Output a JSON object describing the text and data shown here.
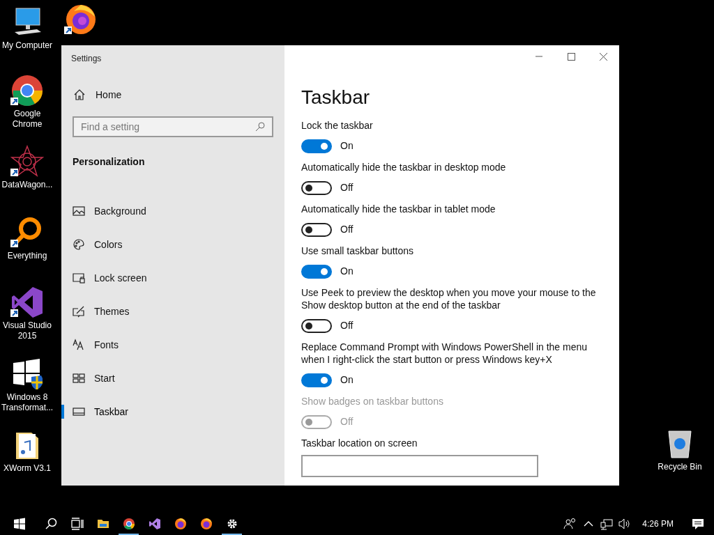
{
  "desktop_icons": [
    {
      "kind": "computer",
      "label": "My Computer",
      "shortcut": false
    },
    {
      "kind": "chrome",
      "label": "Google Chrome",
      "shortcut": true
    },
    {
      "kind": "star",
      "label": "DataWagon...",
      "shortcut": true
    },
    {
      "kind": "magnifier",
      "label": "Everything",
      "shortcut": true
    },
    {
      "kind": "vs",
      "label": "Visual Studio 2015",
      "shortcut": true
    },
    {
      "kind": "windows",
      "label": "Windows 8 Transformat...",
      "shortcut": false
    },
    {
      "kind": "folder",
      "label": "XWorm V3.1",
      "shortcut": false
    }
  ],
  "desktop_right_icons": [
    {
      "kind": "recycle",
      "label": "Recycle Bin"
    }
  ],
  "hidden_icon": {
    "kind": "firefox",
    "shortcut": true
  },
  "window": {
    "title": "Settings",
    "sidebar": {
      "home": "Home",
      "search": {
        "placeholder": "Find a setting"
      },
      "section": "Personalization",
      "items": [
        {
          "kind": "picture",
          "label": "Background",
          "selected": false
        },
        {
          "kind": "palette",
          "label": "Colors",
          "selected": false
        },
        {
          "kind": "lock",
          "label": "Lock screen",
          "selected": false
        },
        {
          "kind": "brush",
          "label": "Themes",
          "selected": false
        },
        {
          "kind": "fonts",
          "label": "Fonts",
          "selected": false
        },
        {
          "kind": "start",
          "label": "Start",
          "selected": false
        },
        {
          "kind": "taskbar",
          "label": "Taskbar",
          "selected": true
        }
      ]
    },
    "content": {
      "heading": "Taskbar",
      "settings": [
        {
          "kind": "toggle",
          "label": "Lock the taskbar",
          "on": true,
          "disabled": false,
          "state_text": "On"
        },
        {
          "kind": "toggle",
          "label": "Automatically hide the taskbar in desktop mode",
          "on": false,
          "disabled": false,
          "state_text": "Off"
        },
        {
          "kind": "toggle",
          "label": "Automatically hide the taskbar in tablet mode",
          "on": false,
          "disabled": false,
          "state_text": "Off"
        },
        {
          "kind": "toggle",
          "label": "Use small taskbar buttons",
          "on": true,
          "disabled": false,
          "state_text": "On"
        },
        {
          "kind": "toggle",
          "label": "Use Peek to preview the desktop when you move your mouse to the Show desktop button at the end of the taskbar",
          "on": false,
          "disabled": false,
          "state_text": "Off"
        },
        {
          "kind": "toggle",
          "label": "Replace Command Prompt with Windows PowerShell in the menu when I right-click the start button or press Windows key+X",
          "on": true,
          "disabled": false,
          "state_text": "On"
        },
        {
          "kind": "toggle",
          "label": "Show badges on taskbar buttons",
          "on": false,
          "disabled": true,
          "state_text": "Off"
        },
        {
          "kind": "dropdown",
          "label": "Taskbar location on screen"
        }
      ]
    }
  },
  "taskbar": {
    "apps": [
      {
        "kind": "start",
        "running": false
      },
      {
        "kind": "search",
        "running": false
      },
      {
        "kind": "taskview",
        "running": false
      },
      {
        "kind": "explorer",
        "running": false
      },
      {
        "kind": "chrome",
        "running": true
      },
      {
        "kind": "vs",
        "running": false
      },
      {
        "kind": "firefox",
        "running": false
      },
      {
        "kind": "firefox",
        "running": false
      },
      {
        "kind": "settings",
        "running": true
      }
    ],
    "tray": [
      {
        "kind": "people"
      },
      {
        "kind": "chevron"
      },
      {
        "kind": "network"
      },
      {
        "kind": "volume"
      }
    ],
    "clock": "4:26 PM"
  }
}
